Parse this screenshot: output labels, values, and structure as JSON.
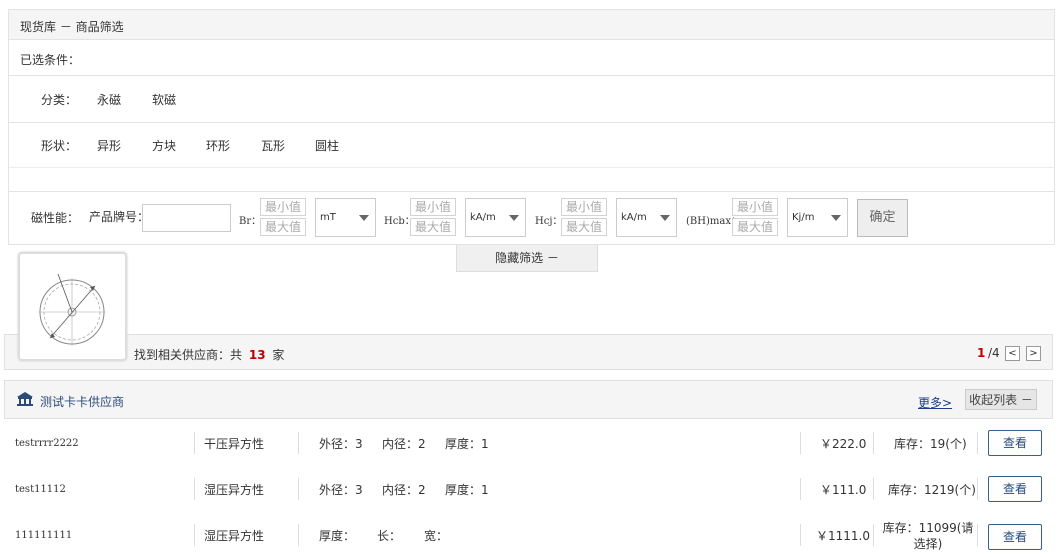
{
  "breadcrumb": "现货库 － 商品筛选",
  "selected_conditions_label": "已选条件：",
  "category": {
    "label": "分类：",
    "options": [
      "永磁",
      "软磁"
    ]
  },
  "shape": {
    "label": "形状：",
    "options": [
      "异形",
      "方块",
      "环形",
      "瓦形",
      "圆柱"
    ]
  },
  "magnetic": {
    "label": "磁性能：",
    "brand_label": "产品牌号：",
    "min_placeholder": "最小值",
    "max_placeholder": "最大值",
    "fields": [
      {
        "label": "Br：",
        "unit": "mT"
      },
      {
        "label": "Hcb：",
        "unit": "kA/m"
      },
      {
        "label": "Hcj：",
        "unit": "kA/m"
      },
      {
        "label": "(BH)max：",
        "unit": "Kj/m"
      }
    ],
    "confirm_label": "确定"
  },
  "hide_filter_label": "隐藏筛选 －",
  "found": {
    "prefix": "找到相关供应商：共",
    "count": "13",
    "suffix": "家"
  },
  "pagination": {
    "current": "1",
    "total": "/4",
    "prev": "<",
    "next": ">"
  },
  "supplier": {
    "name": "测试卡卡供应商",
    "more_label": "更多>",
    "collapse_label": "收起列表 －"
  },
  "rows": [
    {
      "code": "testrrrr2222",
      "type": "干压异方性",
      "d1": "外径：3",
      "d2": "内径：2",
      "d3": "厚度：1",
      "price": "￥222.0",
      "stock": "库存：19(个)",
      "view": "查看"
    },
    {
      "code": "test11112",
      "type": "湿压异方性",
      "d1": "外径：3",
      "d2": "内径：2",
      "d3": "厚度：1",
      "price": "￥111.0",
      "stock": "库存：1219(个)",
      "view": "查看"
    },
    {
      "code": "111111111",
      "type": "湿压异方性",
      "d1": "厚度：",
      "d2": "长：",
      "d3": "宽：",
      "price": "￥1111.0",
      "stock": "库存：11099(请选择)",
      "view": "查看"
    }
  ],
  "colors": {
    "accent": "#2b4a78",
    "count": "#c00000",
    "link": "#1a3e8a"
  }
}
